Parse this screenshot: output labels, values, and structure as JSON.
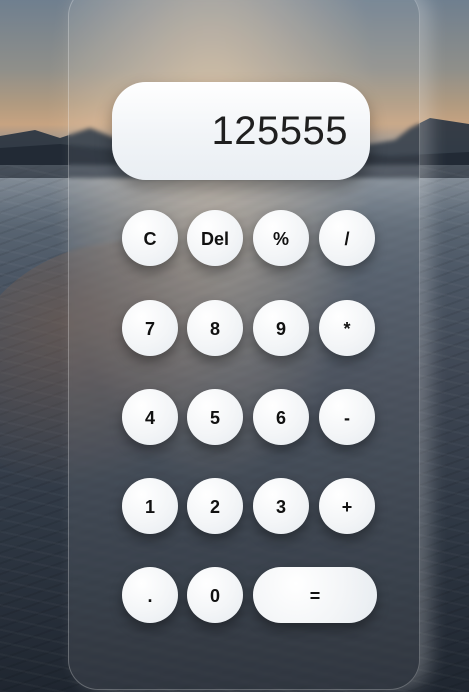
{
  "calculator": {
    "display_value": "125555",
    "buttons": {
      "clear": "C",
      "delete": "Del",
      "percent": "%",
      "divide": "/",
      "seven": "7",
      "eight": "8",
      "nine": "9",
      "multiply": "*",
      "four": "4",
      "five": "5",
      "six": "6",
      "minus": "-",
      "one": "1",
      "two": "2",
      "three": "3",
      "plus": "+",
      "decimal": ".",
      "zero": "0",
      "equals": "="
    }
  }
}
